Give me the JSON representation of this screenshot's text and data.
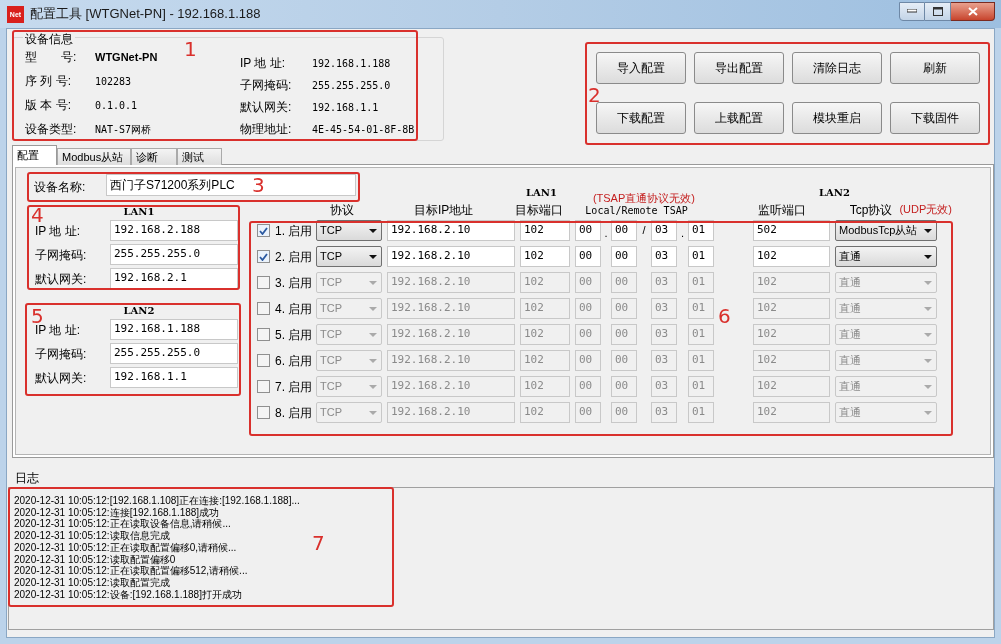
{
  "window": {
    "icon_text": "Net",
    "title": "配置工具 [WTGNet-PN] - 192.168.1.188"
  },
  "device_info": {
    "title": "设备信息",
    "left": [
      {
        "label": "型　　号:",
        "value": "WTGNet-PN"
      },
      {
        "label": "序 列 号:",
        "value": "102283"
      },
      {
        "label": "版 本 号:",
        "value": "0.1.0.1"
      },
      {
        "label": "设备类型:",
        "value": "NAT-S7网桥"
      }
    ],
    "right": [
      {
        "label": "IP 地 址:",
        "value": "192.168.1.188"
      },
      {
        "label": "子网掩码:",
        "value": "255.255.255.0"
      },
      {
        "label": "默认网关:",
        "value": "192.168.1.1"
      },
      {
        "label": "物理地址:",
        "value": "4E-45-54-01-8F-8B"
      }
    ]
  },
  "buttons": [
    "导入配置",
    "导出配置",
    "清除日志",
    "刷新",
    "下载配置",
    "上载配置",
    "模块重启",
    "下载固件"
  ],
  "tabs": [
    {
      "label": "配置",
      "selected": true
    },
    {
      "label": "Modbus从站",
      "selected": false
    },
    {
      "label": "诊断",
      "selected": false
    },
    {
      "label": "测试",
      "selected": false
    }
  ],
  "device_name": {
    "label": "设备名称:",
    "value": "西门子S71200系列PLC"
  },
  "lan1": {
    "title": "LAN1",
    "fields": [
      {
        "label": "IP 地 址:",
        "value": "192.168.2.188"
      },
      {
        "label": "子网掩码:",
        "value": "255.255.255.0"
      },
      {
        "label": "默认网关:",
        "value": "192.168.2.1"
      }
    ]
  },
  "lan2": {
    "title": "LAN2",
    "fields": [
      {
        "label": "IP 地 址:",
        "value": "192.168.1.188"
      },
      {
        "label": "子网掩码:",
        "value": "255.255.255.0"
      },
      {
        "label": "默认网关:",
        "value": "192.168.1.1"
      }
    ]
  },
  "table": {
    "lan1_header": "LAN1",
    "tsap_note": "(TSAP直通协议无效)",
    "lan2_header": "LAN2",
    "udp_note": "(UDP无效)",
    "columns": [
      "协议",
      "目标IP地址",
      "目标端口",
      "Local/Remote TSAP",
      "监听端口",
      "Tcp协议"
    ],
    "tsap_separators": [
      ".",
      "/",
      "."
    ],
    "rows": [
      {
        "checked": true,
        "label": "1. 启用",
        "protocol": "TCP",
        "ip": "192.168.2.10",
        "port": "102",
        "tsap": [
          "00",
          "00",
          "03",
          "01"
        ],
        "listen_port": "502",
        "tcp_protocol": "ModbusTcp从站"
      },
      {
        "checked": true,
        "label": "2. 启用",
        "protocol": "TCP",
        "ip": "192.168.2.10",
        "port": "102",
        "tsap": [
          "00",
          "00",
          "03",
          "01"
        ],
        "listen_port": "102",
        "tcp_protocol": "直通"
      },
      {
        "checked": false,
        "label": "3. 启用",
        "protocol": "TCP",
        "ip": "192.168.2.10",
        "port": "102",
        "tsap": [
          "00",
          "00",
          "03",
          "01"
        ],
        "listen_port": "102",
        "tcp_protocol": "直通"
      },
      {
        "checked": false,
        "label": "4. 启用",
        "protocol": "TCP",
        "ip": "192.168.2.10",
        "port": "102",
        "tsap": [
          "00",
          "00",
          "03",
          "01"
        ],
        "listen_port": "102",
        "tcp_protocol": "直通"
      },
      {
        "checked": false,
        "label": "5. 启用",
        "protocol": "TCP",
        "ip": "192.168.2.10",
        "port": "102",
        "tsap": [
          "00",
          "00",
          "03",
          "01"
        ],
        "listen_port": "102",
        "tcp_protocol": "直通"
      },
      {
        "checked": false,
        "label": "6. 启用",
        "protocol": "TCP",
        "ip": "192.168.2.10",
        "port": "102",
        "tsap": [
          "00",
          "00",
          "03",
          "01"
        ],
        "listen_port": "102",
        "tcp_protocol": "直通"
      },
      {
        "checked": false,
        "label": "7. 启用",
        "protocol": "TCP",
        "ip": "192.168.2.10",
        "port": "102",
        "tsap": [
          "00",
          "00",
          "03",
          "01"
        ],
        "listen_port": "102",
        "tcp_protocol": "直通"
      },
      {
        "checked": false,
        "label": "8. 启用",
        "protocol": "TCP",
        "ip": "192.168.2.10",
        "port": "102",
        "tsap": [
          "00",
          "00",
          "03",
          "01"
        ],
        "listen_port": "102",
        "tcp_protocol": "直通"
      }
    ]
  },
  "log": {
    "title": "日志",
    "lines": [
      "2020-12-31 10:05:12:[192.168.1.108]正在连接:[192.168.1.188]...",
      "2020-12-31 10:05:12:连接[192.168.1.188]成功",
      "2020-12-31 10:05:12:正在读取设备信息,请稍候...",
      "2020-12-31 10:05:12:读取信息完成",
      "2020-12-31 10:05:12:正在读取配置偏移0,请稍候...",
      "2020-12-31 10:05:12:读取配置偏移0",
      "2020-12-31 10:05:12:正在读取配置偏移512,请稍候...",
      "2020-12-31 10:05:12:读取配置完成",
      "2020-12-31 10:05:12:设备:[192.168.1.188]打开成功"
    ]
  },
  "annotations": [
    {
      "label": "1"
    },
    {
      "label": "2"
    },
    {
      "label": "3"
    },
    {
      "label": "4"
    },
    {
      "label": "5"
    },
    {
      "label": "6"
    },
    {
      "label": "7"
    }
  ]
}
